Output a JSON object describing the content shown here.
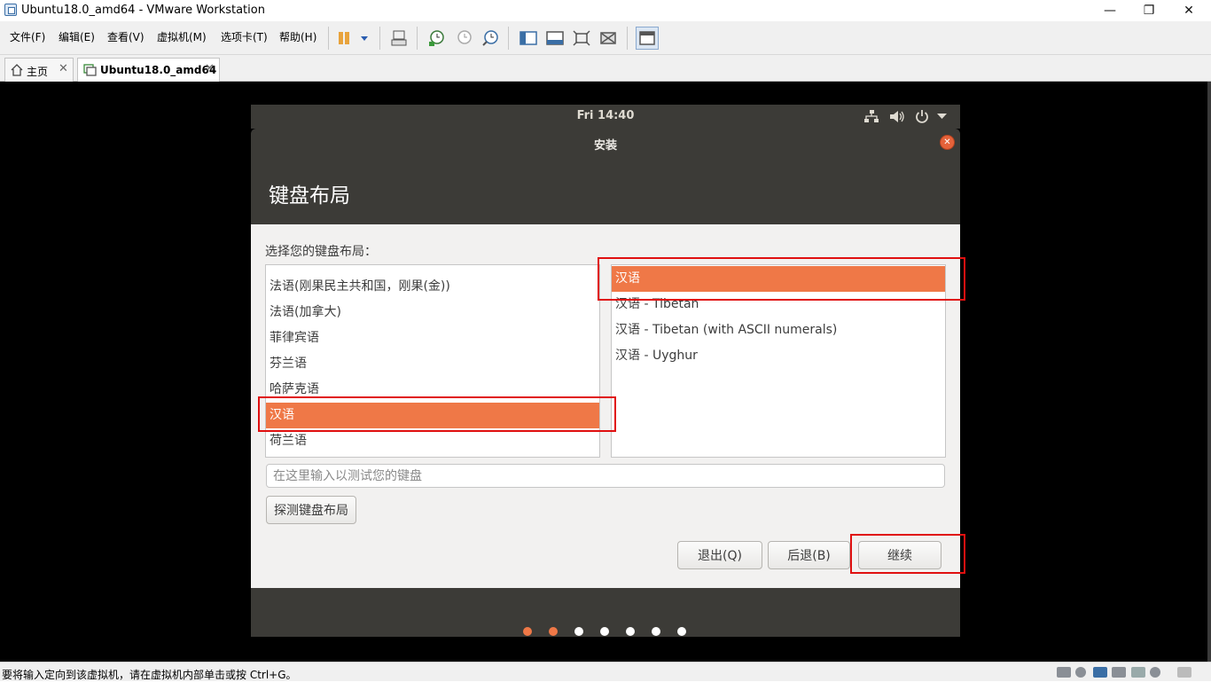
{
  "window": {
    "title": "Ubuntu18.0_amd64 - VMware Workstation"
  },
  "menu": [
    "文件(F)",
    "编辑(E)",
    "查看(V)",
    "虚拟机(M)",
    "选项卡(T)",
    "帮助(H)"
  ],
  "tabs": [
    {
      "label": "主页",
      "icon": "home-icon"
    },
    {
      "label": "Ubuntu18.0_amd64",
      "icon": "vm-icon",
      "active": true
    }
  ],
  "guest": {
    "clock": "Fri 14:40",
    "installer_title": "安装",
    "heading": "键盘布局",
    "prompt": "选择您的键盘布局：",
    "left_list": [
      "法语(刚果民主共和国，刚果(金))",
      "法语(加拿大)",
      "菲律宾语",
      "芬兰语",
      "哈萨克语",
      "汉语",
      "荷兰语"
    ],
    "left_selected": "汉语",
    "right_list": [
      "汉语",
      "汉语 - Tibetan",
      "汉语 - Tibetan (with ASCII numerals)",
      "汉语 - Uyghur"
    ],
    "right_selected": "汉语",
    "test_placeholder": "在这里输入以测试您的键盘",
    "detect_button": "探测键盘布局",
    "quit_button": "退出(Q)",
    "back_button": "后退(B)",
    "continue_button": "继续",
    "progress": {
      "total_steps": 7,
      "completed_steps": 2
    }
  },
  "statusbar": {
    "text": "要将输入定向到该虚拟机，请在虚拟机内部单击或按 Ctrl+G。"
  },
  "colors": {
    "accent": "#ef7847",
    "highlight_box": "#e01010",
    "guest_dark": "#3c3b37"
  }
}
